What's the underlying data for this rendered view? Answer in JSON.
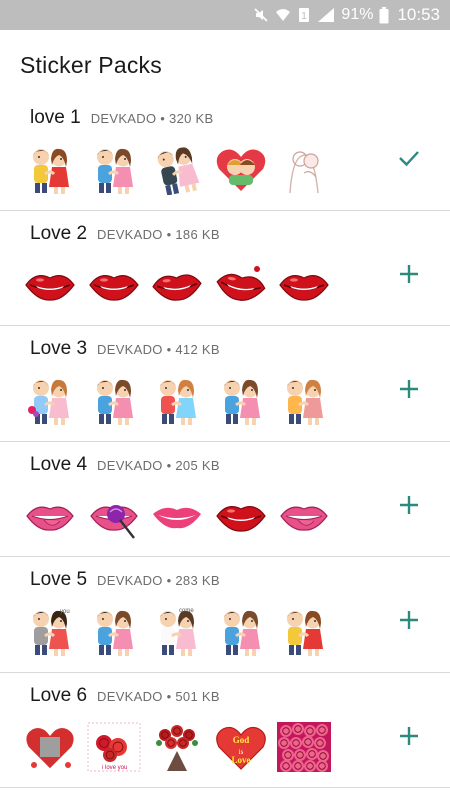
{
  "status_bar": {
    "battery_percent": "91%",
    "time": "10:53",
    "icons": [
      "mute-icon",
      "wifi-icon",
      "data-icon",
      "signal-icon",
      "battery-icon"
    ]
  },
  "app": {
    "title": "Sticker Packs",
    "accent_color": "#2b8a7e"
  },
  "packs": [
    {
      "name": "love 1",
      "meta": "DEVKADO • 320 KB",
      "action": "added-check-icon",
      "stickers": [
        "couple-hug-sticker",
        "couple-kiss-sticker",
        "couple-lift-sticker",
        "heart-couple-sticker",
        "sketch-couple-sticker"
      ]
    },
    {
      "name": "Love 2",
      "meta": "DEVKADO • 186 KB",
      "action": "add-plus-icon",
      "stickers": [
        "red-lips-sticker",
        "red-lips-sticker",
        "lip-bite-sticker",
        "lips-open-sticker",
        "red-lips-sticker"
      ]
    },
    {
      "name": "Love 3",
      "meta": "DEVKADO • 412 KB",
      "action": "add-plus-icon",
      "stickers": [
        "couple-flowers-sticker",
        "couple-kiss-sticker",
        "couple-sit-sticker",
        "couple-kiss-sticker",
        "couple-holding-hands-sticker"
      ]
    },
    {
      "name": "Love 4",
      "meta": "DEVKADO • 205 KB",
      "action": "add-plus-icon",
      "stickers": [
        "lips-tongue-sticker",
        "lips-lollipop-sticker",
        "lips-smile-sticker",
        "red-lips-sticker",
        "lips-tongue-sticker"
      ]
    },
    {
      "name": "Love 5",
      "meta": "DEVKADO • 283 KB",
      "action": "add-plus-icon",
      "stickers": [
        "couple-cuddle-sticker",
        "couple-kiss-sticker",
        "couple-touch-sticker",
        "couple-kiss-sticker",
        "couple-hug-sticker"
      ]
    },
    {
      "name": "Love 6",
      "meta": "DEVKADO • 501 KB",
      "action": "add-plus-icon",
      "stickers": [
        "heart-photo-sticker",
        "roses-sticker",
        "rose-bouquet-sticker",
        "god-is-love-heart-sticker",
        "pink-roses-photo-sticker"
      ]
    }
  ]
}
